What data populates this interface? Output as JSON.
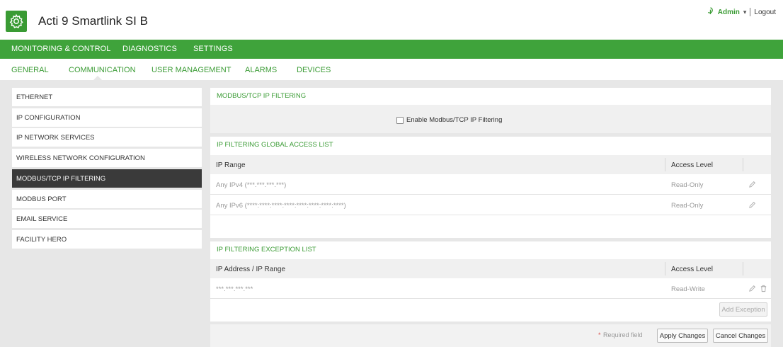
{
  "app": {
    "title": "Acti 9 Smartlink SI B"
  },
  "user": {
    "name": "Admin",
    "dropdown": "▾",
    "logout": "Logout"
  },
  "main_nav": [
    "MONITORING & CONTROL",
    "DIAGNOSTICS",
    "SETTINGS"
  ],
  "sub_tabs": [
    "GENERAL",
    "COMMUNICATION",
    "USER MANAGEMENT",
    "ALARMS",
    "DEVICES"
  ],
  "sidebar": [
    "ETHERNET",
    "IP CONFIGURATION",
    "IP NETWORK SERVICES",
    "WIRELESS NETWORK CONFIGURATION",
    "MODBUS/TCP IP FILTERING",
    "MODBUS PORT",
    "EMAIL SERVICE",
    "FACILITY HERO"
  ],
  "filtering": {
    "title": "MODBUS/TCP IP FILTERING",
    "enable_label": "Enable Modbus/TCP IP Filtering",
    "enabled": false
  },
  "global_list": {
    "title": "IP FILTERING GLOBAL ACCESS LIST",
    "col_range": "IP Range",
    "col_access": "Access Level",
    "rows": [
      {
        "range": "Any IPv4 (***.***.***.***)",
        "access": "Read-Only"
      },
      {
        "range": "Any IPv6 (****:****:****:****:****:****:****:****)",
        "access": "Read-Only"
      }
    ]
  },
  "exception_list": {
    "title": "IP FILTERING EXCEPTION LIST",
    "col_range": "IP Address / IP Range",
    "col_access": "Access Level",
    "rows": [
      {
        "range": "***.***.***.***",
        "access": "Read-Write"
      }
    ],
    "add_button": "Add Exception"
  },
  "footer": {
    "required_star": "*",
    "required_text": "Required field",
    "apply": "Apply Changes",
    "cancel": "Cancel Changes"
  },
  "colors": {
    "brand_green": "#3fa33b",
    "active_dark": "#3a3a3a",
    "required_red": "#d9534f"
  },
  "icons": {
    "settings": "gear-icon",
    "user": "user-icon",
    "edit": "pencil-icon",
    "delete": "trash-icon"
  }
}
